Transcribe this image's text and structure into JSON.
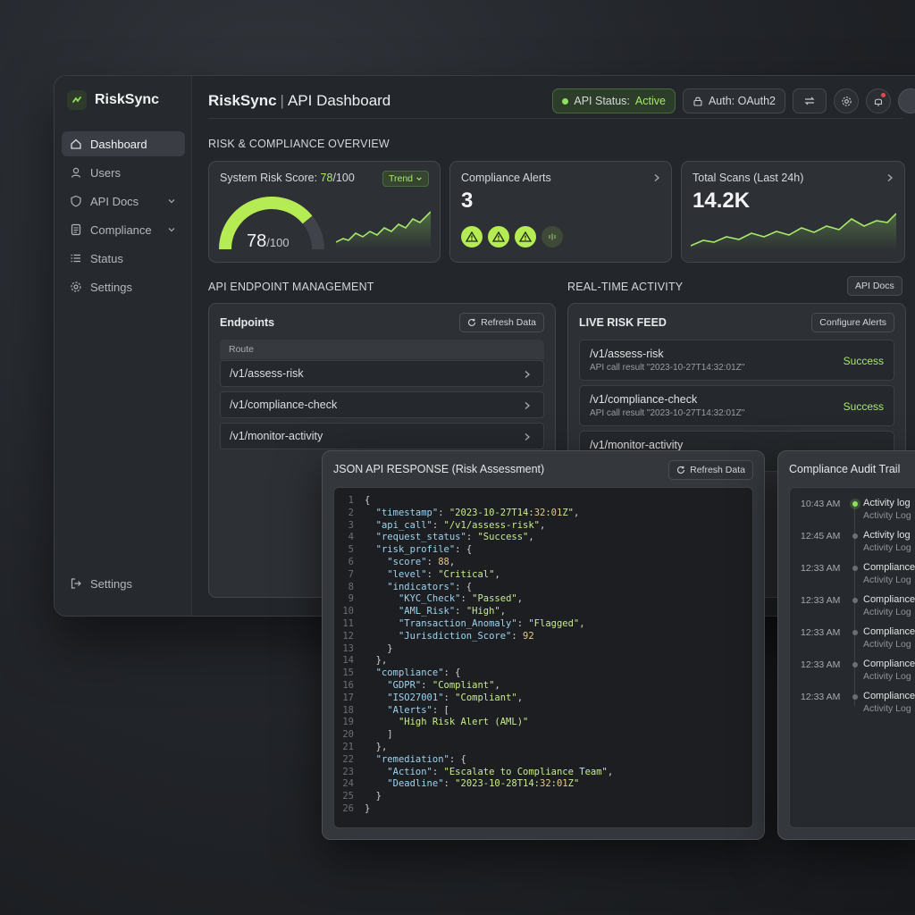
{
  "app": {
    "name": "RiskSync",
    "page_title_app": "RiskSync",
    "page_title_sep": "|",
    "page_title": "API Dashboard"
  },
  "sidebar": {
    "items": [
      {
        "label": "Dashboard",
        "icon": "home-icon",
        "active": true
      },
      {
        "label": "Users",
        "icon": "user-icon"
      },
      {
        "label": "API Docs",
        "icon": "shield-icon",
        "expandable": true
      },
      {
        "label": "Compliance",
        "icon": "document-icon",
        "expandable": true
      },
      {
        "label": "Status",
        "icon": "list-icon"
      },
      {
        "label": "Settings",
        "icon": "gear-icon"
      }
    ],
    "bottom_label": "Settings"
  },
  "topbar": {
    "api_status_label": "API Status:",
    "api_status_value": "Active",
    "auth_label": "Auth: OAuth2"
  },
  "overview": {
    "title": "RISK & COMPLIANCE OVERVIEW",
    "risk": {
      "label_prefix": "System Risk Score:",
      "score": "78",
      "max": "/100",
      "value": 78,
      "trend_label": "Trend"
    },
    "alerts": {
      "label": "Compliance Alerts",
      "count": "3"
    },
    "scans": {
      "label": "Total Scans (Last 24h)",
      "value": "14.2K"
    }
  },
  "endpoints": {
    "section_title": "API ENDPOINT MANAGEMENT",
    "panel_title": "Endpoints",
    "refresh_label": "Refresh Data",
    "column": "Route",
    "routes": [
      "/v1/assess-risk",
      "/v1/compliance-check",
      "/v1/monitor-activity"
    ]
  },
  "activity": {
    "section_title": "REAL-TIME ACTIVITY",
    "api_docs_label": "API Docs",
    "panel_title": "LIVE RISK FEED",
    "configure_label": "Configure Alerts",
    "feed": [
      {
        "route": "/v1/assess-risk",
        "sub": "API call result \"2023-10-27T14:32:01Z\"",
        "status": "Success"
      },
      {
        "route": "/v1/compliance-check",
        "sub": "API call result \"2023-10-27T14:32:01Z\"",
        "status": "Success"
      },
      {
        "route": "/v1/monitor-activity",
        "sub": "",
        "status": ""
      }
    ]
  },
  "json_panel": {
    "title": "JSON API RESPONSE (Risk Assessment)",
    "refresh_label": "Refresh Data",
    "lines": [
      "{",
      "  \"timestamp\": \"2023-10-27T14:32:01Z\",",
      "  \"api_call\": \"/v1/assess-risk\",",
      "  \"request_status\": \"Success\",",
      "  \"risk_profile\": {",
      "    \"score\": 88,",
      "    \"level\": \"Critical\",",
      "    \"indicators\": {",
      "      \"KYC_Check\": \"Passed\",",
      "      \"AML_Risk\": \"High\",",
      "      \"Transaction_Anomaly\": \"Flagged\",",
      "      \"Jurisdiction_Score\": 92",
      "    }",
      "  },",
      "  \"compliance\": {",
      "    \"GDPR\": \"Compliant\",",
      "    \"ISO27001\": \"Compliant\",",
      "    \"Alerts\": [",
      "      \"High Risk Alert (AML)\"",
      "    ]",
      "  },",
      "  \"remediation\": {",
      "    \"Action\": \"Escalate to Compliance Team\",",
      "    \"Deadline\": \"2023-10-28T14:32:01Z\"",
      "  }",
      "}"
    ]
  },
  "audit": {
    "title": "Compliance Audit Trail",
    "entries": [
      {
        "time": "10:43 AM",
        "main": "Activity log",
        "sub": "Activity Log",
        "live": true
      },
      {
        "time": "12:45 AM",
        "main": "Activity log",
        "sub": "Activity Log"
      },
      {
        "time": "12:33 AM",
        "main": "Compliance",
        "sub": "Activity Log"
      },
      {
        "time": "12:33 AM",
        "main": "Compliance",
        "sub": "Activity Log"
      },
      {
        "time": "12:33 AM",
        "main": "Compliance",
        "sub": "Activity Log"
      },
      {
        "time": "12:33 AM",
        "main": "Compliance",
        "sub": "Activity Log"
      },
      {
        "time": "12:33 AM",
        "main": "Compliance",
        "sub": "Activity Log"
      }
    ]
  },
  "colors": {
    "accent": "#a6e86a",
    "warn_badge": "#b6ec53",
    "background": "#23262a"
  }
}
